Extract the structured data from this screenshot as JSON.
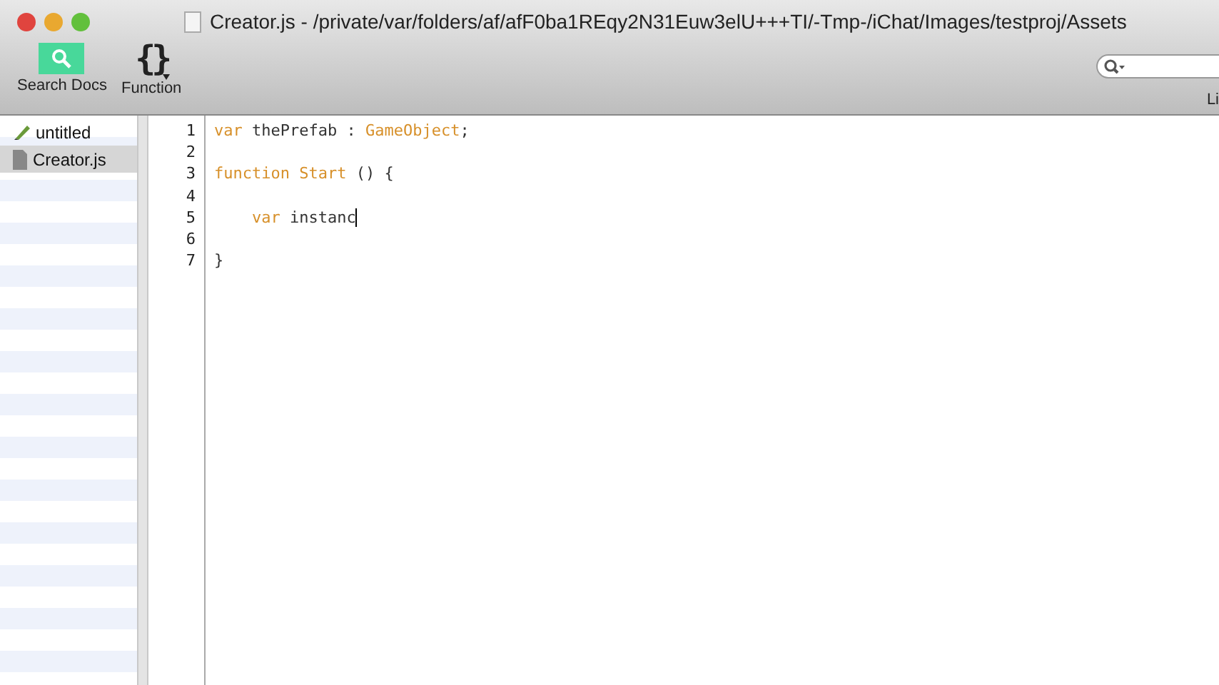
{
  "window": {
    "title": "Creator.js - /private/var/folders/af/afF0ba1REqy2N31Euw3elU+++TI/-Tmp-/iChat/Images/testproj/Assets"
  },
  "toolbar": {
    "items": [
      {
        "kind": "search",
        "label": "Search Docs"
      },
      {
        "kind": "function",
        "label": "Function",
        "glyph": "{}"
      }
    ],
    "cut_label": "Li"
  },
  "files": [
    {
      "name": "untitled",
      "selected": false,
      "kind": "new"
    },
    {
      "name": "Creator.js",
      "selected": true,
      "kind": "doc"
    }
  ],
  "editor": {
    "lines": [
      {
        "number": "1",
        "tokens": [
          {
            "kind": "keyword",
            "text": "var"
          },
          {
            "kind": "plain",
            "text": " thePrefab : "
          },
          {
            "kind": "type",
            "text": "GameObject"
          },
          {
            "kind": "plain",
            "text": ";"
          }
        ]
      },
      {
        "number": "2"
      },
      {
        "number": "3",
        "tokens": [
          {
            "kind": "keyword",
            "text": "function"
          },
          {
            "kind": "keyword",
            "text": " Start"
          },
          {
            "kind": "plain",
            "text": " () {"
          }
        ]
      },
      {
        "number": "4"
      },
      {
        "number": "5",
        "indent": true,
        "cursor": true,
        "tokens": [
          {
            "kind": "keyword",
            "text": "var"
          },
          {
            "kind": "plain",
            "text": " instanc"
          }
        ]
      },
      {
        "number": "6"
      },
      {
        "number": "7",
        "tokens": [
          {
            "kind": "plain",
            "text": "}"
          }
        ]
      }
    ]
  }
}
